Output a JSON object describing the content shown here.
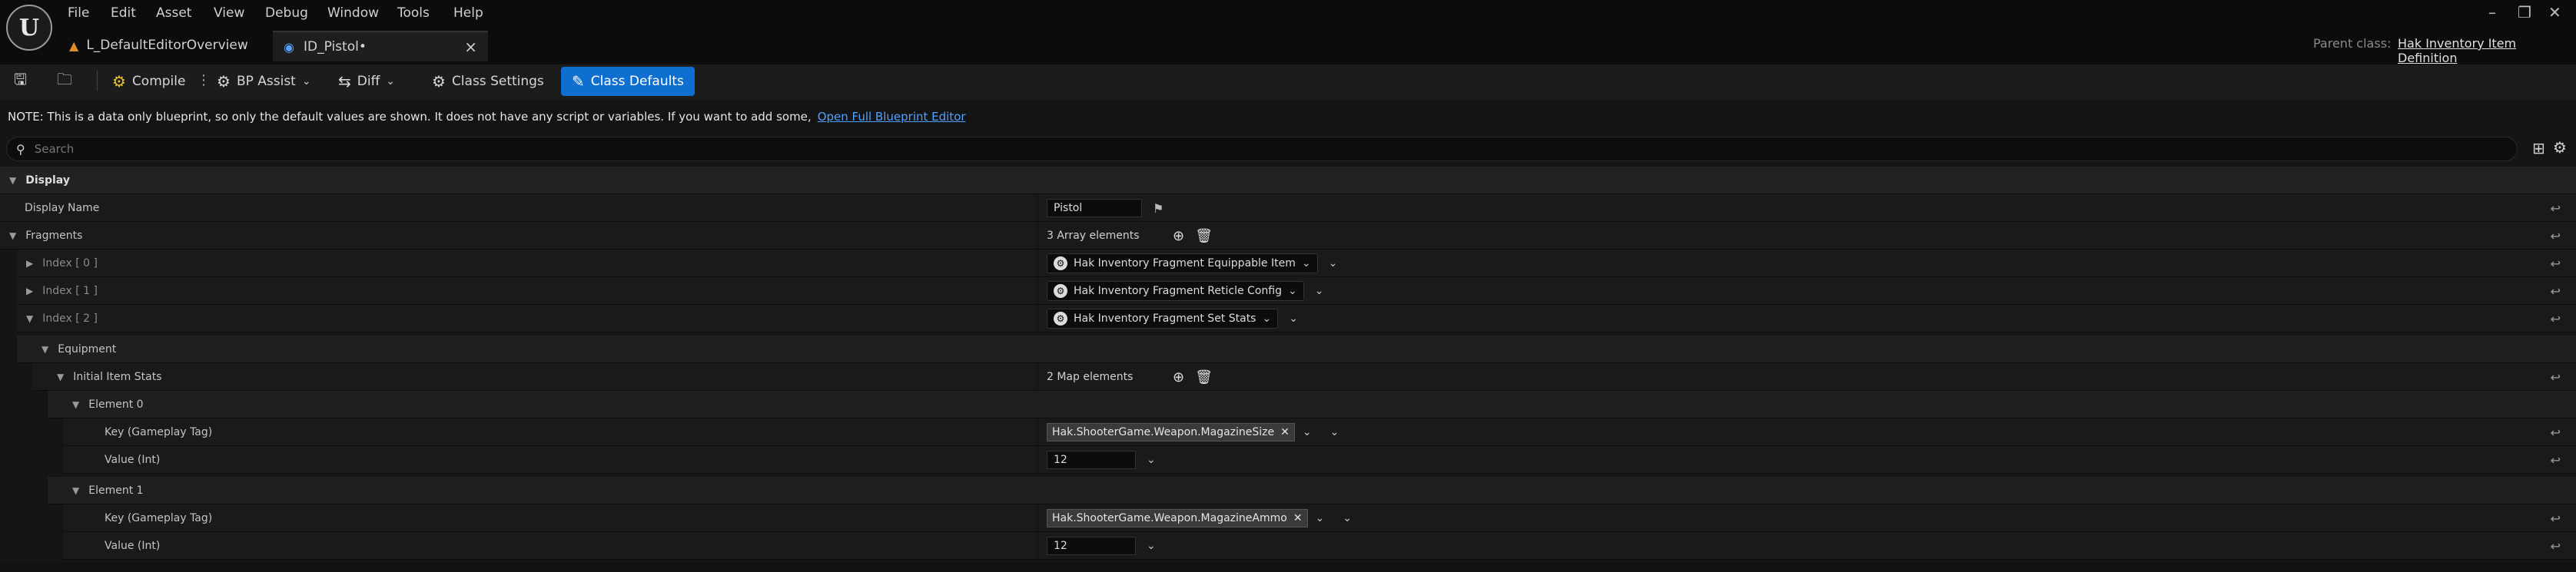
{
  "menu": [
    "File",
    "Edit",
    "Asset",
    "View",
    "Debug",
    "Window",
    "Tools",
    "Help"
  ],
  "tabs": [
    {
      "label": "L_DefaultEditorOverview",
      "icon": "level-icon"
    },
    {
      "label": "ID_Pistol•",
      "icon": "blueprint-icon"
    }
  ],
  "tab_close": "×",
  "window_controls": {
    "minimize": "–",
    "restore": "❐",
    "close": "✕"
  },
  "parent_class": {
    "label": "Parent class:",
    "value": "Hak Inventory Item Definition"
  },
  "toolbar": {
    "compile": "Compile",
    "bp_assist": "BP Assist",
    "diff": "Diff",
    "class_settings": "Class Settings",
    "class_defaults": "Class Defaults"
  },
  "note": {
    "text": "NOTE: This is a data only blueprint, so only the default values are shown.  It does not have any script or variables.  If you want to add some,",
    "link": "Open Full Blueprint Editor"
  },
  "search": {
    "placeholder": "Search"
  },
  "details": {
    "display_category": "Display",
    "display_name_label": "Display Name",
    "display_name_value": "Pistol",
    "fragments_label": "Fragments",
    "fragments_count": "3 Array elements",
    "index0_label": "Index [ 0 ]",
    "index0_value": "Hak Inventory Fragment Equippable Item",
    "index1_label": "Index [ 1 ]",
    "index1_value": "Hak Inventory Fragment Reticle Config",
    "index2_label": "Index [ 2 ]",
    "index2_value": "Hak Inventory Fragment Set Stats",
    "equipment_label": "Equipment",
    "initial_stats_label": "Initial Item Stats",
    "initial_stats_count": "2 Map elements",
    "element0_label": "Element 0",
    "element0_key_label": "Key (Gameplay Tag)",
    "element0_key_value": "Hak.ShooterGame.Weapon.MagazineSize",
    "element0_value_label": "Value (Int)",
    "element0_value": "12",
    "element1_label": "Element 1",
    "element1_key_label": "Key (Gameplay Tag)",
    "element1_key_value": "Hak.ShooterGame.Weapon.MagazineAmmo",
    "element1_value_label": "Value (Int)",
    "element1_value": "12"
  }
}
